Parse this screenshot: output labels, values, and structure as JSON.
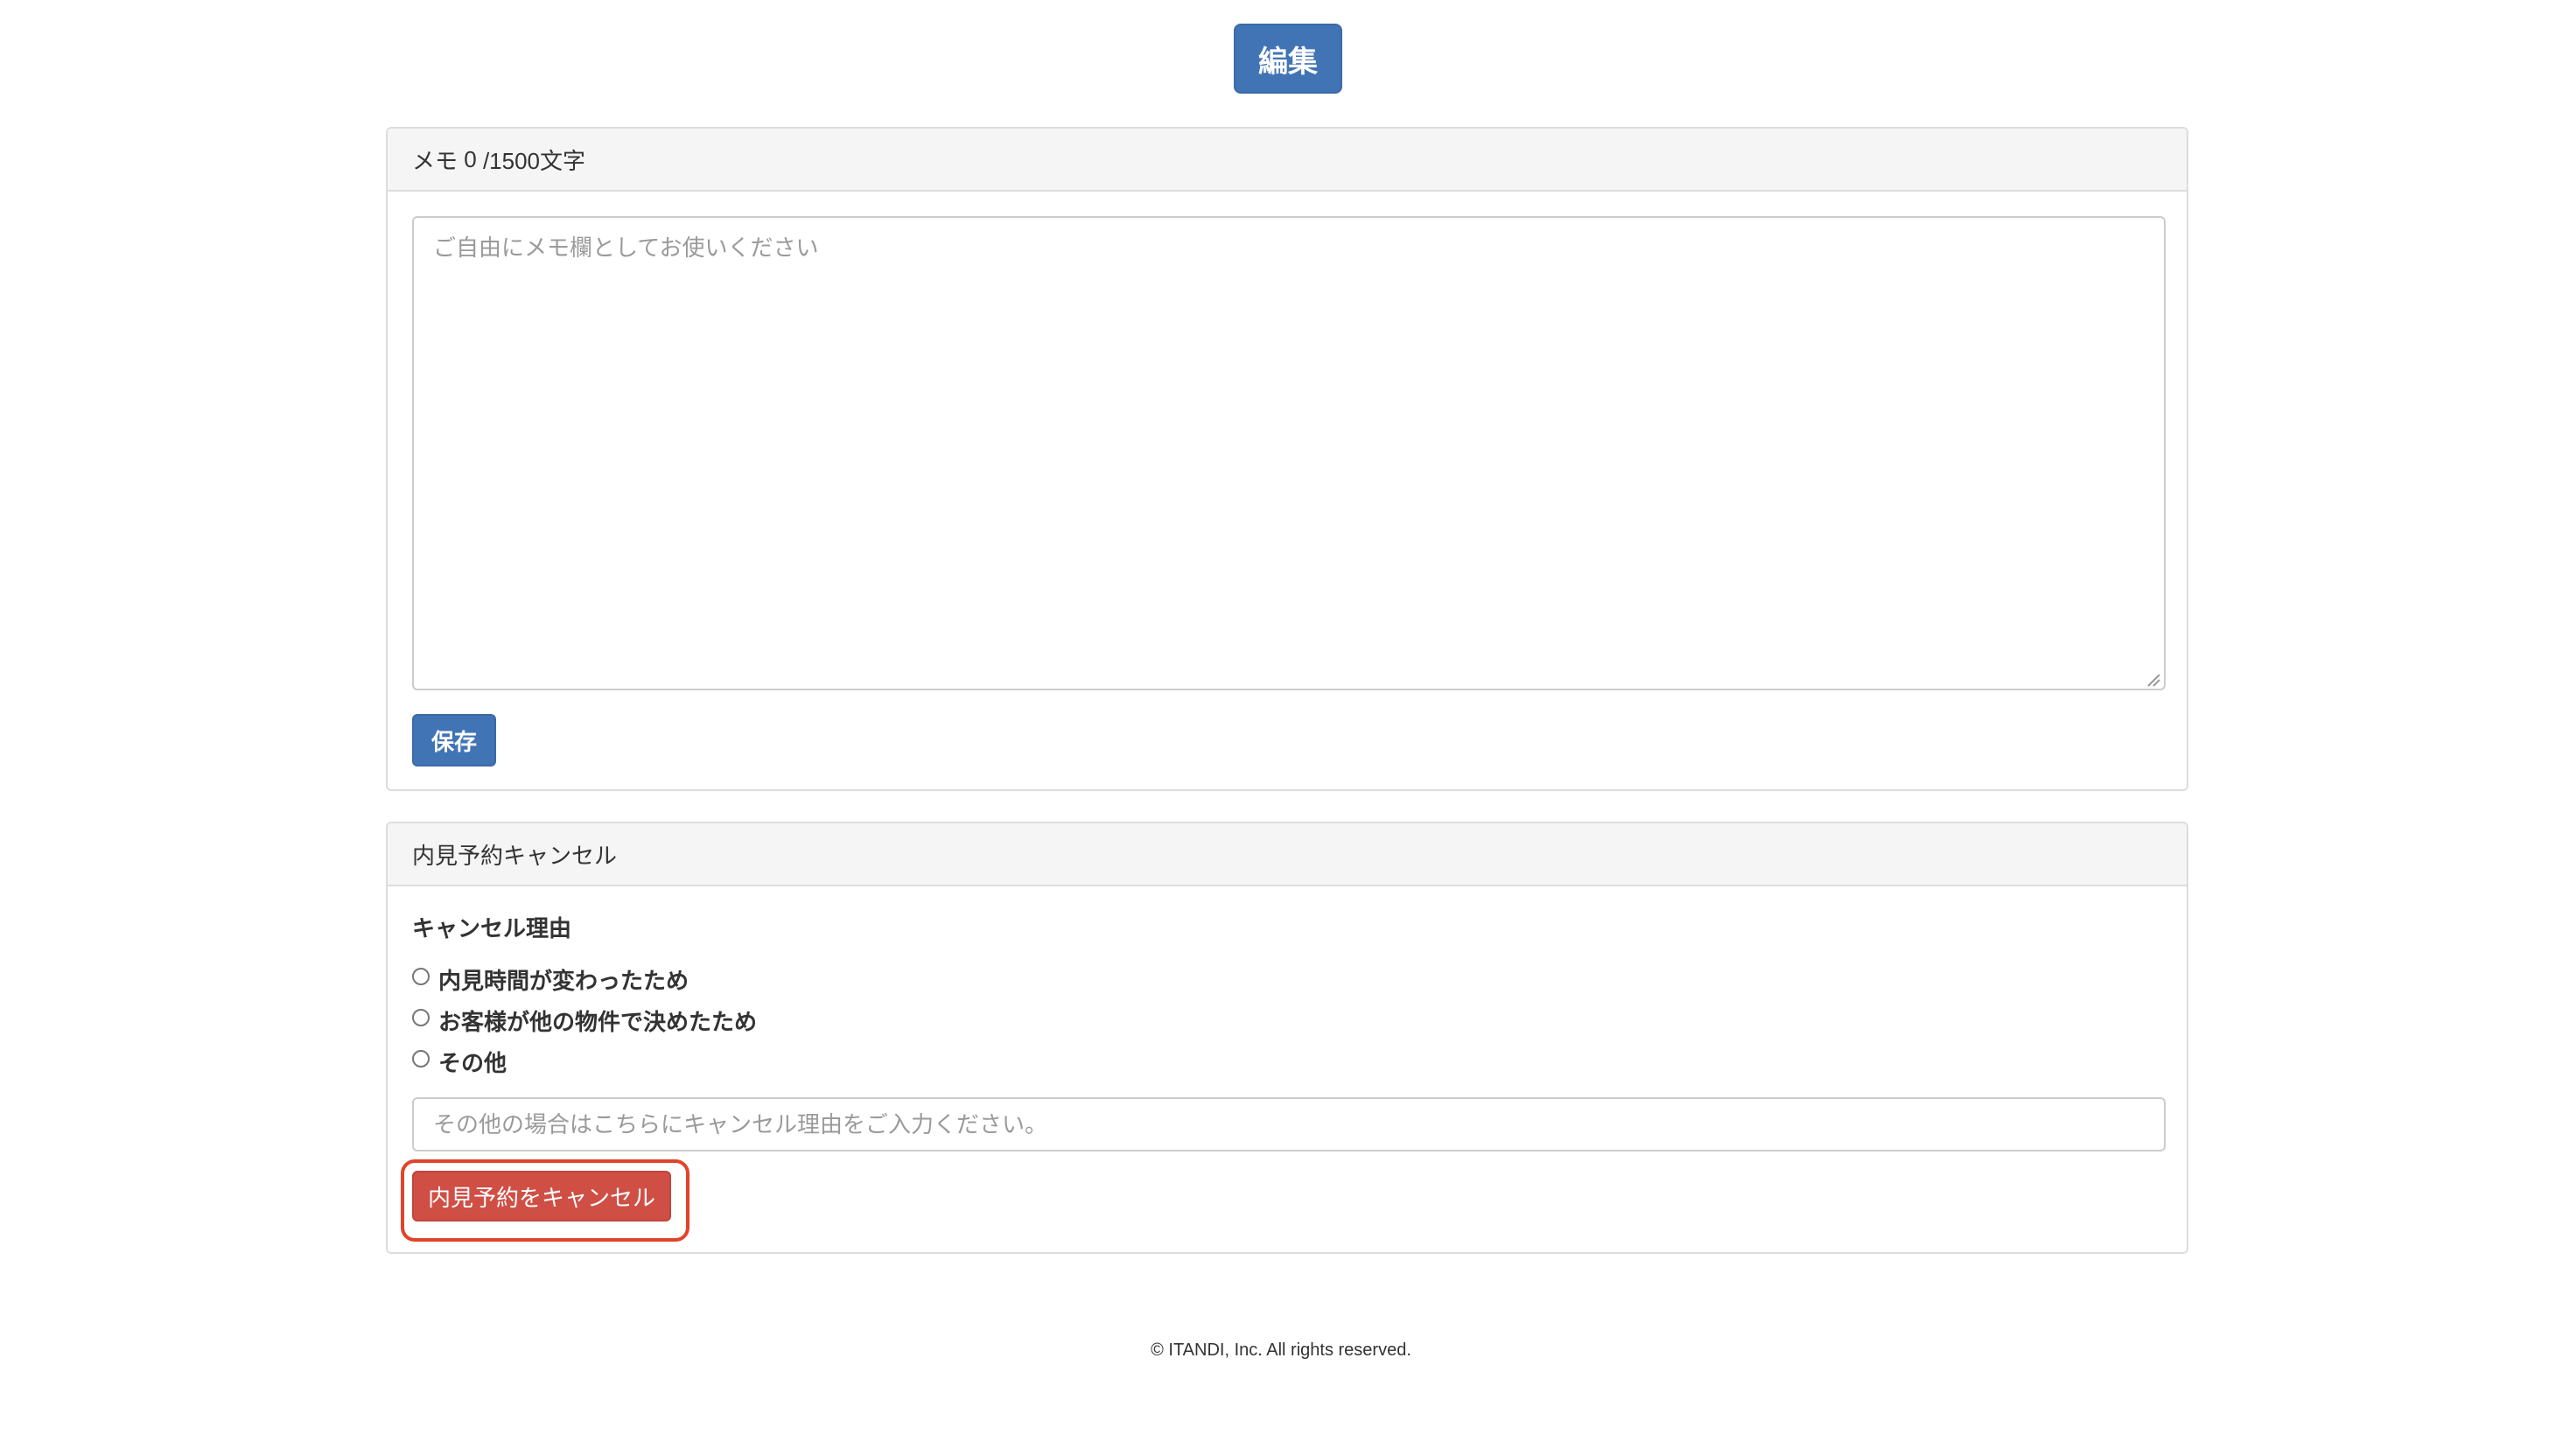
{
  "header": {
    "edit_label": "編集"
  },
  "memo": {
    "heading_prefix": "メモ",
    "current_count": "0",
    "limit_label": "/1500文字",
    "placeholder": "ご自由にメモ欄としてお使いください",
    "save_label": "保存"
  },
  "cancel": {
    "heading": "内見予約キャンセル",
    "reason_title": "キャンセル理由",
    "reasons": [
      {
        "label": "内見時間が変わったため",
        "selected": false
      },
      {
        "label": "お客様が他の物件で決めたため",
        "selected": false
      },
      {
        "label": "その他",
        "selected": false
      }
    ],
    "other_placeholder": "その他の場合はこちらにキャンセル理由をご入力ください。",
    "cancel_button_label": "内見予約をキャンセル"
  },
  "footer": {
    "copyright": "© ITANDI, Inc. All rights reserved."
  },
  "colors": {
    "primary": "#4174b5",
    "danger": "#cf4f45",
    "highlight": "#e0442b",
    "panel_heading_bg": "#f5f5f5"
  }
}
